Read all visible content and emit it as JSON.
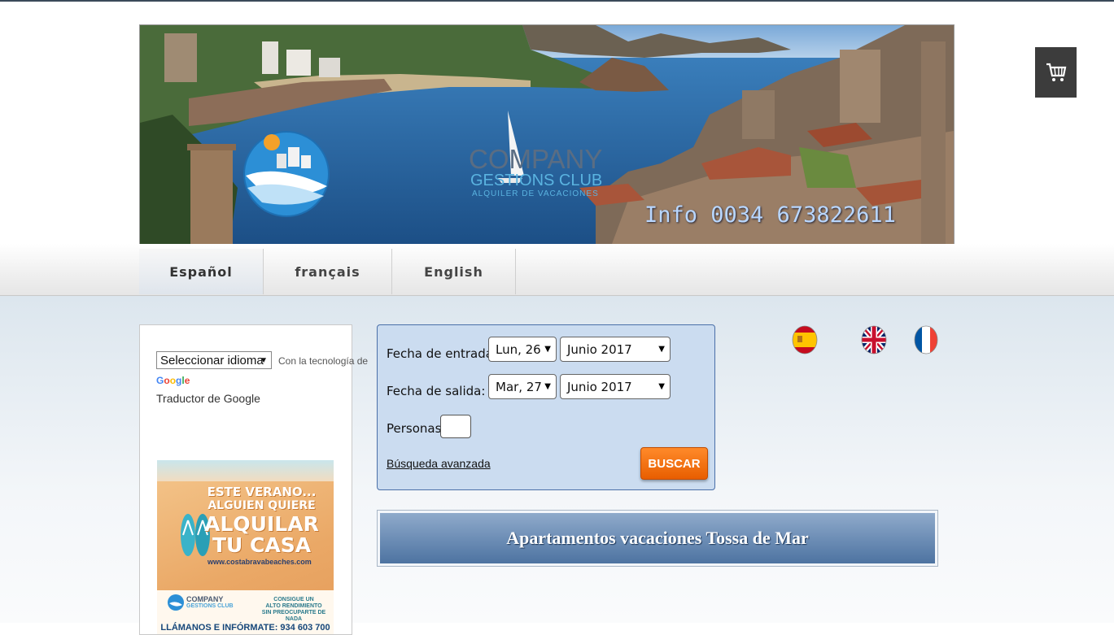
{
  "header": {
    "logo_line1": "COMPANY",
    "logo_line2": "GESTIONS CLUB",
    "logo_line3": "ALQUILER DE VACACIONES",
    "info_phone": "Info 0034 673822611"
  },
  "cart": {
    "icon": "cart-icon"
  },
  "nav": {
    "tabs": [
      {
        "label": "Español",
        "active": true
      },
      {
        "label": "français",
        "active": false
      },
      {
        "label": "English",
        "active": false
      }
    ]
  },
  "translate": {
    "select_label": "Seleccionar idioma",
    "powered_by": "Con la tecnología de",
    "google": "Google",
    "translator": "Traductor de Google"
  },
  "ad": {
    "line1": "ESTE VERANO...",
    "line2": "ALGUIEN QUIERE",
    "line3": "ALQUILAR",
    "line4": "TU CASA",
    "url": "www.costabravabeaches.com",
    "company": "COMPANY",
    "company_sub": "GESTIONS CLUB",
    "pitch1": "CONSIGUE UN",
    "pitch2": "ALTO RENDIMIENTO",
    "pitch3": "SIN PREOCUPARTE DE NADA",
    "call": "LLÁMANOS E INFÓRMATE: 934 603 700"
  },
  "search": {
    "checkin_label": "Fecha de entrada:",
    "checkin_day": "Lun, 26",
    "checkin_month": "Junio 2017",
    "checkout_label": "Fecha de salida:",
    "checkout_day": "Mar, 27",
    "checkout_month": "Junio 2017",
    "persons_label": "Personas:",
    "persons_value": "",
    "advanced_link": "Búsqueda avanzada",
    "search_button": "BUSCAR"
  },
  "flags": [
    "flag-spain-icon",
    "flag-uk-icon",
    "flag-france-icon"
  ],
  "page_title": "Apartamentos vacaciones Tossa de Mar",
  "colors": {
    "accent_orange": "#f06a0a",
    "search_bg": "#cbdcf0",
    "title_blue": "#4d73a1"
  }
}
